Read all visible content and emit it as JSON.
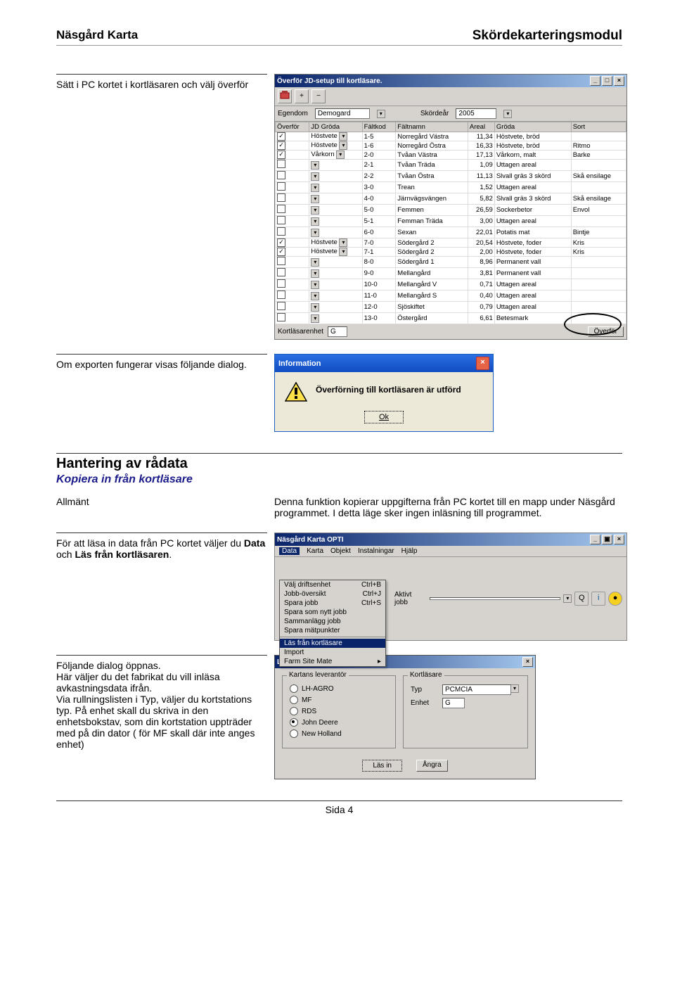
{
  "header": {
    "left": "Näsgård Karta",
    "right": "Skördekarteringsmodul"
  },
  "step1": {
    "caption": "Sätt i PC kortet i kortläsaren och välj överför"
  },
  "step2": {
    "caption": "Om exporten fungerar  visas följande dialog."
  },
  "section": {
    "h1": "Hantering av rådata",
    "h2": "Kopiera in från kortläsare",
    "left": "Allmänt",
    "right": "Denna funktion kopierar uppgifterna från PC kortet till en mapp under Näsgård programmet. I detta läge sker ingen inläsning till programmet."
  },
  "step3": {
    "caption": "För att läsa in data från PC kortet väljer du Data och Läs från kortläsaren.",
    "bold": [
      "Data",
      "Läs från kortläsaren"
    ]
  },
  "step4": {
    "caption": "Följande dialog öppnas.\nHär väljer du det fabrikat du vill inläsa avkastningsdata ifrån.\nVia rullningslisten i Typ, väljer du kortstations typ. På enhet skall du skriva in den enhetsbokstav, som din kortstation uppträder med på din dator ( för MF skall där inte anges enhet)"
  },
  "footer": "Sida 4",
  "sc1": {
    "title": "Överför JD-setup till kortläsare.",
    "egendom_label": "Egendom",
    "egendom_value": "Demogard",
    "year_label": "Skördeår",
    "year_value": "2005",
    "cols": [
      "Överför",
      "JD Gröda",
      "Fältkod",
      "Fältnamn",
      "Areal",
      "Gröda",
      "Sort"
    ],
    "rows": [
      {
        "c": true,
        "jd": "Höstvete",
        "kod": "1-5",
        "namn": "Norregård Västra",
        "ar": "11,34",
        "gr": "Höstvete, bröd",
        "s": ""
      },
      {
        "c": true,
        "jd": "Höstvete",
        "kod": "1-6",
        "namn": "Norregård Östra",
        "ar": "16,33",
        "gr": "Höstvete, bröd",
        "s": "Ritmo"
      },
      {
        "c": true,
        "jd": "Vårkorn",
        "kod": "2-0",
        "namn": "Tvåan Västra",
        "ar": "17,13",
        "gr": "Vårkorn, malt",
        "s": "Barke"
      },
      {
        "c": false,
        "jd": "",
        "kod": "2-1",
        "namn": "Tvåan Träda",
        "ar": "1,09",
        "gr": "Uttagen areal",
        "s": ""
      },
      {
        "c": false,
        "jd": "",
        "kod": "2-2",
        "namn": "Tvåan Östra",
        "ar": "11,13",
        "gr": "Slvall gräs 3 skörd",
        "s": "Skå ensilage"
      },
      {
        "c": false,
        "jd": "",
        "kod": "3-0",
        "namn": "Trean",
        "ar": "1,52",
        "gr": "Uttagen areal",
        "s": ""
      },
      {
        "c": false,
        "jd": "",
        "kod": "4-0",
        "namn": "Järnvägsvängen",
        "ar": "5,82",
        "gr": "Slvall gräs 3 skörd",
        "s": "Skå ensilage"
      },
      {
        "c": false,
        "jd": "",
        "kod": "5-0",
        "namn": "Femmen",
        "ar": "26,59",
        "gr": "Sockerbetor",
        "s": "Envol"
      },
      {
        "c": false,
        "jd": "",
        "kod": "5-1",
        "namn": "Femman Träda",
        "ar": "3,00",
        "gr": "Uttagen areal",
        "s": ""
      },
      {
        "c": false,
        "jd": "",
        "kod": "6-0",
        "namn": "Sexan",
        "ar": "22,01",
        "gr": "Potatis mat",
        "s": "Bintje"
      },
      {
        "c": true,
        "jd": "Höstvete",
        "kod": "7-0",
        "namn": "Södergård 2",
        "ar": "20,54",
        "gr": "Höstvete, foder",
        "s": "Kris"
      },
      {
        "c": true,
        "jd": "Höstvete",
        "kod": "7-1",
        "namn": "Södergård 2",
        "ar": "2,00",
        "gr": "Höstvete, foder",
        "s": "Kris"
      },
      {
        "c": false,
        "jd": "",
        "kod": "8-0",
        "namn": "Södergård 1",
        "ar": "8,96",
        "gr": "Permanent vall",
        "s": ""
      },
      {
        "c": false,
        "jd": "",
        "kod": "9-0",
        "namn": "Mellangård",
        "ar": "3,81",
        "gr": "Permanent vall",
        "s": ""
      },
      {
        "c": false,
        "jd": "",
        "kod": "10-0",
        "namn": "Mellangård V",
        "ar": "0,71",
        "gr": "Uttagen areal",
        "s": ""
      },
      {
        "c": false,
        "jd": "",
        "kod": "11-0",
        "namn": "Mellangård S",
        "ar": "0,40",
        "gr": "Uttagen areal",
        "s": ""
      },
      {
        "c": false,
        "jd": "",
        "kod": "12-0",
        "namn": "Sjöskiftet",
        "ar": "0,79",
        "gr": "Uttagen areal",
        "s": ""
      },
      {
        "c": false,
        "jd": "",
        "kod": "13-0",
        "namn": "Östergård",
        "ar": "6,61",
        "gr": "Betesmark",
        "s": ""
      }
    ],
    "unit_label": "Kortläsarenhet",
    "unit_value": "G",
    "transfer_btn": "Överför"
  },
  "sc2": {
    "title": "Information",
    "msg": "Överförning till kortläsaren är utförd",
    "ok": "Ok"
  },
  "sc3": {
    "title": "Näsgård Karta OPTI",
    "menus": [
      "Data",
      "Karta",
      "Objekt",
      "Instalningar",
      "Hjälp"
    ],
    "items": [
      {
        "l": "Välj driftsenhet",
        "k": "Ctrl+B"
      },
      {
        "l": "Jobb-översikt",
        "k": "Ctrl+J"
      },
      {
        "l": "Spara jobb",
        "k": "Ctrl+S"
      },
      {
        "l": "Spara som nytt jobb",
        "k": ""
      },
      {
        "l": "Sammanlägg jobb",
        "k": ""
      },
      {
        "l": "Spara mätpunkter",
        "k": ""
      }
    ],
    "items2": [
      {
        "l": "Läs från kortläsare",
        "k": "",
        "sel": true
      },
      {
        "l": "Import",
        "k": ""
      },
      {
        "l": "Farm Site Mate",
        "k": "▸"
      }
    ],
    "job_label": "Aktivt jobb"
  },
  "sc4": {
    "title": "Läs från kortläsare",
    "group1": "Kartans leverantör",
    "vendors": [
      "LH-AGRO",
      "MF",
      "RDS",
      "John Deere",
      "New Holland"
    ],
    "vendor_sel": 3,
    "group2": "Kortläsare",
    "typ_label": "Typ",
    "typ_value": "PCMCIA",
    "enhet_label": "Enhet",
    "enhet_value": "G",
    "read_btn": "Läs in",
    "cancel_btn": "Ångra"
  }
}
